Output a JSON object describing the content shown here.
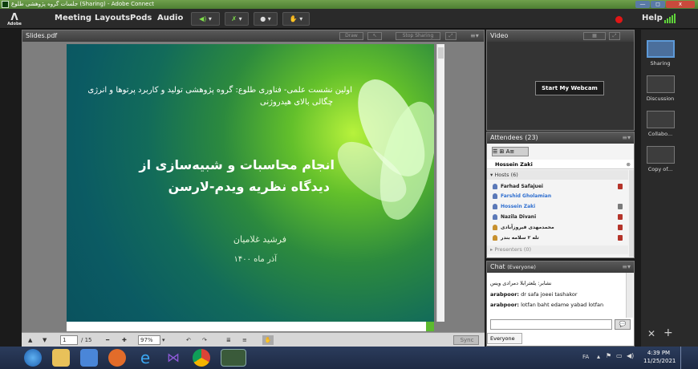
{
  "window": {
    "title": "(Sharing) - Adobe Connect",
    "title_rtl": "جلسات گروه پژوهشی طلوع",
    "minimize": "—",
    "maximize": "◻",
    "close": "x"
  },
  "menubar": {
    "logo": "Adobe",
    "items": [
      "Meeting",
      "Layouts",
      "Pods",
      "Audio"
    ],
    "help": "Help"
  },
  "share_pod": {
    "title": "Slides.pdf",
    "draw": "Draw",
    "stop_sharing": "Stop Sharing"
  },
  "slide": {
    "line1": "اولین نشست علمی- فناوری طلوع: گروه پژوهشی تولید و کاربرد پرتوها و انرژی",
    "line2": "چگالی بالای هیدروژنی",
    "title1": "انجام محاسبات و شبیه‌سازی از",
    "title2": "دیدگاه نظریه ویدم-لارسن",
    "author": "فرشید غلامیان",
    "date": "آذر ماه ۱۴۰۰"
  },
  "slide_toolbar": {
    "page": "1",
    "total": "/ 15",
    "zoom": "97%",
    "sync": "Sync"
  },
  "video_pod": {
    "title": "Video",
    "start_webcam": "Start My Webcam"
  },
  "attendees_pod": {
    "title": "Attendees",
    "count": "(23)",
    "self": "Hossein Zaki",
    "hosts_label": "Hosts (6)",
    "hosts": [
      "Farhad Safajuei",
      "Farshid Gholamian",
      "Hossein Zaki",
      "Nazila Divani",
      "محمدمهدی فیروزآبادی",
      "تله ۲ سلامه بندر"
    ],
    "presenters_label": "Presenters (0)"
  },
  "chat_pod": {
    "title": "Chat",
    "scope": "(Everyone)",
    "messages": [
      {
        "text": "نشابر: یلعثرابلا دمرادی ویس"
      },
      {
        "sender": "arabpoor:",
        "text": " dr safa joeei tashakor"
      },
      {
        "sender": "arabpoor:",
        "text": " lotfan baht edame yabad lotfan"
      }
    ],
    "recipient": "Everyone"
  },
  "layouts": [
    "Sharing",
    "Discussion",
    "Collabo...",
    "Copy of..."
  ],
  "taskbar": {
    "lang": "FA",
    "time": "4:39 PM",
    "date": "11/25/2021"
  },
  "colors": {
    "accent_green": "#4d7e32",
    "host_blue": "#2f6fd0",
    "record_red": "#e01616"
  }
}
